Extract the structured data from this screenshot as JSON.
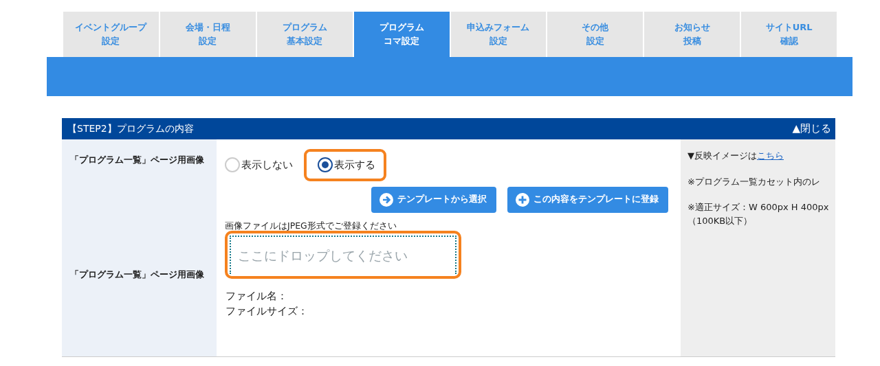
{
  "tabs": [
    {
      "lines": [
        "イベントグループ",
        "設定"
      ],
      "selected": false
    },
    {
      "lines": [
        "会場・日程",
        "設定"
      ],
      "selected": false
    },
    {
      "lines": [
        "プログラム",
        "基本設定"
      ],
      "selected": false
    },
    {
      "lines": [
        "プログラム",
        "コマ設定"
      ],
      "selected": true
    },
    {
      "lines": [
        "申込みフォーム",
        "設定"
      ],
      "selected": false
    },
    {
      "lines": [
        "その他",
        "設定"
      ],
      "selected": false
    },
    {
      "lines": [
        "お知らせ",
        "投稿"
      ],
      "selected": false
    },
    {
      "lines": [
        "サイトURL",
        "確認"
      ],
      "selected": false
    }
  ],
  "section": {
    "title": "【STEP2】プログラムの内容",
    "toggle": "▲閉じる",
    "labels": [
      "「プログラム一覧」ページ用画像",
      "「プログラム一覧」ページ用画像"
    ],
    "radios": [
      {
        "label": "表示しない",
        "selected": false,
        "highlighted": false
      },
      {
        "label": "表示する",
        "selected": true,
        "highlighted": true
      }
    ],
    "buttons": [
      {
        "kind": "arrow",
        "label": "テンプレートから選択"
      },
      {
        "kind": "plus",
        "label": "この内容をテンプレートに登録"
      }
    ],
    "upload_hint": "画像ファイルはJPEG形式でご登録ください",
    "dropzone": {
      "placeholder": "ここにドロップしてください",
      "highlighted": true
    },
    "file_info": [
      "ファイル名：",
      "ファイルサイズ："
    ],
    "notes": [
      {
        "text": "▼反映イメージは",
        "link": "こちら"
      },
      {
        "text": "※プログラム一覧カセット内のレ"
      },
      {
        "text": "※適正サイズ：W 600px H 400px（100KB以下）"
      }
    ]
  }
}
